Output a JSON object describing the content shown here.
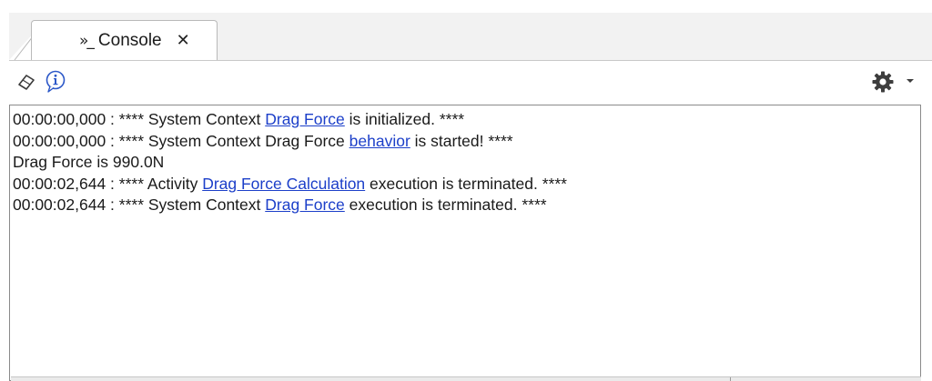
{
  "tab": {
    "icon": "console-prompt-icon",
    "icon_glyph": "»_",
    "label": "Console",
    "close_glyph": "✕"
  },
  "toolbar": {
    "clear_icon": "eraser-icon",
    "info_icon": "info-icon",
    "settings_icon": "gear-icon",
    "settings_caret_icon": "caret-down-icon"
  },
  "console": {
    "lines": [
      {
        "pre": "00:00:00,000 : **** System Context ",
        "link": "Drag Force",
        "post": " is initialized. ****"
      },
      {
        "pre": "00:00:00,000 : **** System Context Drag Force ",
        "link": "behavior",
        "post": " is started! ****"
      },
      {
        "pre": "Drag Force is 990.0N",
        "link": "",
        "post": ""
      },
      {
        "pre": "00:00:02,644 : **** Activity ",
        "link": "Drag Force Calculation",
        "post": " execution is terminated. ****"
      },
      {
        "pre": "00:00:02,644 : **** System Context ",
        "link": "Drag Force",
        "post": " execution is terminated. ****"
      }
    ]
  },
  "colors": {
    "link": "#1c3fc9",
    "tabstrip_bg": "#f2f2f2",
    "border": "#8a8a8a"
  }
}
